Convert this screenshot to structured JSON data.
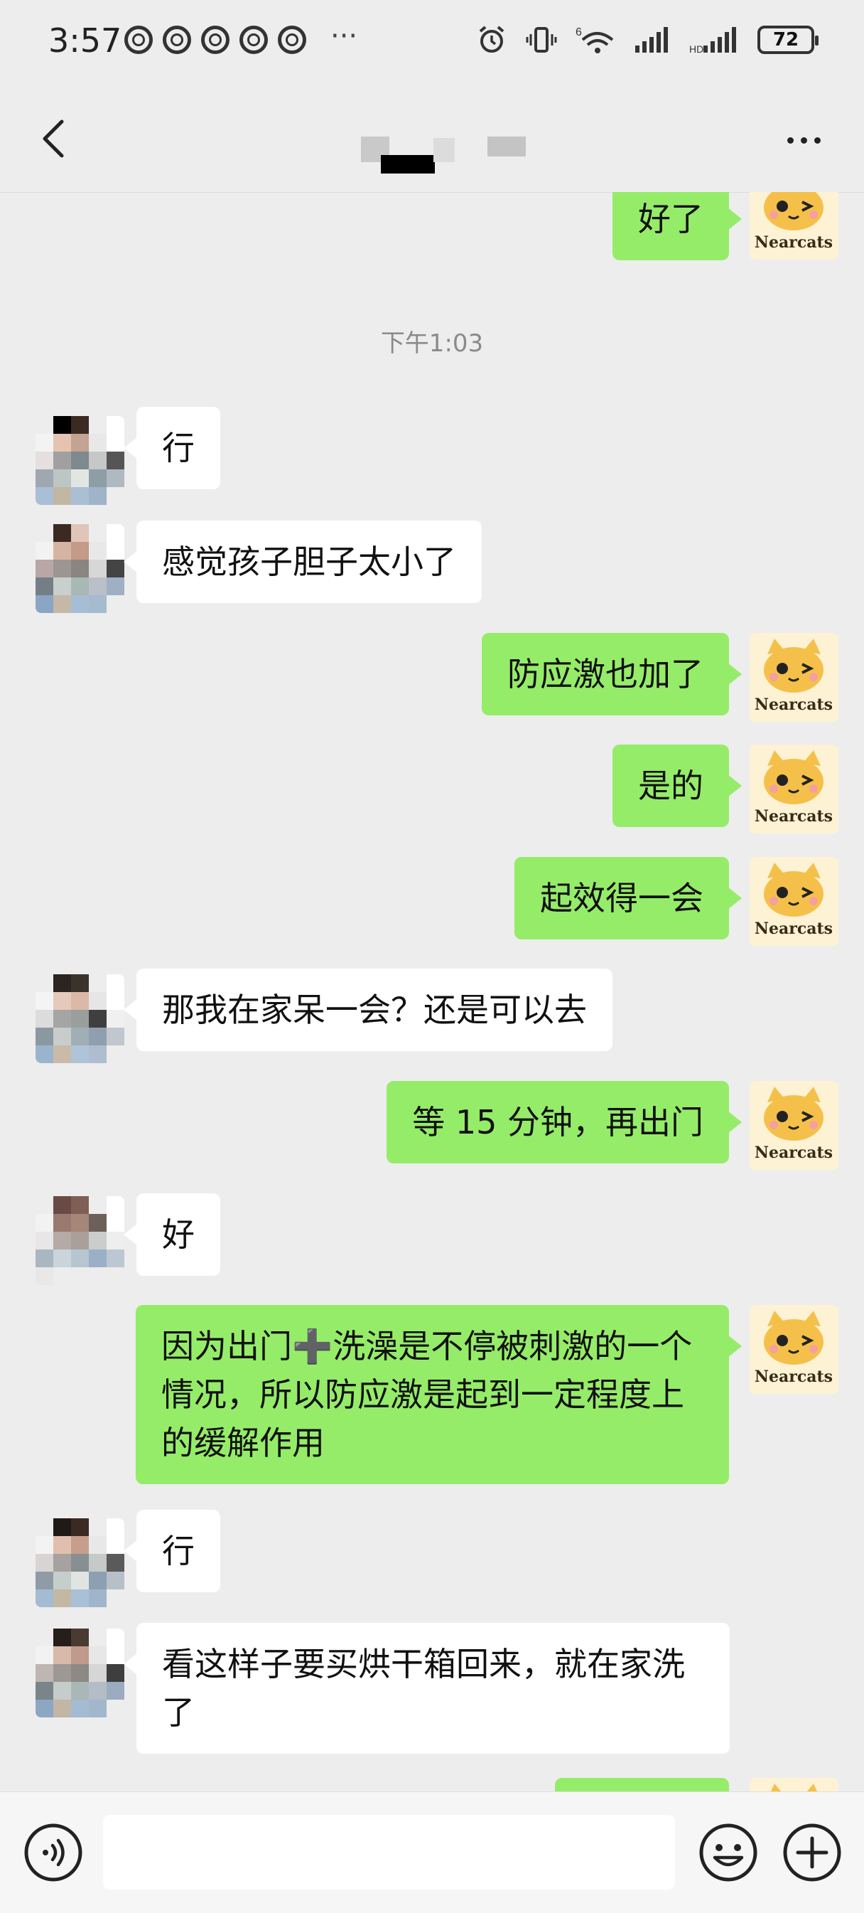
{
  "status_bar": {
    "time": "3:57",
    "more": "···",
    "battery": "72"
  },
  "header": {
    "back_icon": "chevron-left-icon",
    "more_icon": "ellipsis-icon"
  },
  "timestamp": "下午1:03",
  "messages": [
    {
      "side": "out",
      "text": "好了"
    },
    {
      "side": "in",
      "text": "行"
    },
    {
      "side": "in",
      "text": "感觉孩子胆子太小了"
    },
    {
      "side": "out",
      "text": "防应激也加了"
    },
    {
      "side": "out",
      "text": "是的"
    },
    {
      "side": "out",
      "text": "起效得一会"
    },
    {
      "side": "in",
      "text": "那我在家呆一会？还是可以去"
    },
    {
      "side": "out",
      "text": "等 15 分钟，再出门"
    },
    {
      "side": "in",
      "text": "好"
    },
    {
      "side": "out",
      "text": "因为出门➕洗澡是不停被刺激的一个情况，所以防应激是起到一定程度上的缓解作用"
    },
    {
      "side": "in",
      "text": "行"
    },
    {
      "side": "in",
      "text": "看这样子要买烘干箱回来，就在家洗了"
    },
    {
      "side": "out",
      "text": ""
    }
  ],
  "cat_avatar_label": "Nearcats",
  "input_bar": {
    "voice_icon": "voice-icon",
    "emoji_icon": "emoji-icon",
    "plus_icon": "plus-icon"
  },
  "colors": {
    "background": "#ededed",
    "outgoing_bubble": "#95ec69",
    "incoming_bubble": "#ffffff"
  }
}
